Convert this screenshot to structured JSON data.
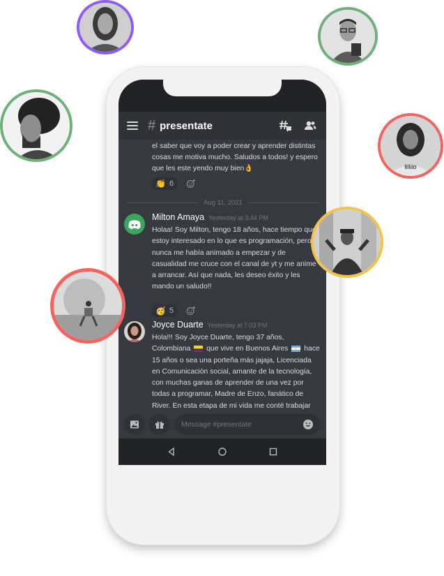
{
  "channel": {
    "name": "presentate",
    "hash": "#"
  },
  "previous_message": {
    "text": "el saber que voy a poder crear y aprender distintas cosas me motiva mucho. Saludos a todos! y espero que les este yendo muy bien👌",
    "reaction": {
      "emoji": "👏",
      "count": "6"
    }
  },
  "date_divider": "Aug 11, 2021",
  "messages": [
    {
      "author": "Milton Amaya",
      "timestamp": "Yesterday at 3:44 PM",
      "text": "Holaa! Soy Milton, tengo 18 años, hace tiempo que estoy interesado  en lo que es programación, pero nunca me había animado a empezar y de casualidad me cruce con el canal de yt y me anime a arrancar. Así que nada, les deseo éxito y les mando un saludo!!",
      "reaction": {
        "emoji": "🥳",
        "count": "5"
      },
      "avatar_color": "#3ba55c"
    },
    {
      "author": "Joyce Duarte",
      "timestamp": "Yesterday at 7:03 PM",
      "text_part1": "Hola!!! Soy Joyce Duarte, tengo 37 años, Colombiana ",
      "text_part2": " que vive en Buenos Aires ",
      "text_part3": " hace 15 años o sea una porteña más jajaja, Licenciada en Comunicación social, amante de la tecnología, con muchas ganas de aprender de una vez por todas a programar, Madre de Enzo, fanático de River. En esta etapa de mi vida me conté trabajar como fondo en..."
    }
  ],
  "composer": {
    "placeholder": "Message #presentate"
  },
  "colors": {
    "ring_purple": "#8b5cf6",
    "ring_green": "#6fb07a",
    "ring_red": "#f4645f",
    "ring_yellow": "#f4c24a",
    "discord_green": "#3ba55c"
  }
}
